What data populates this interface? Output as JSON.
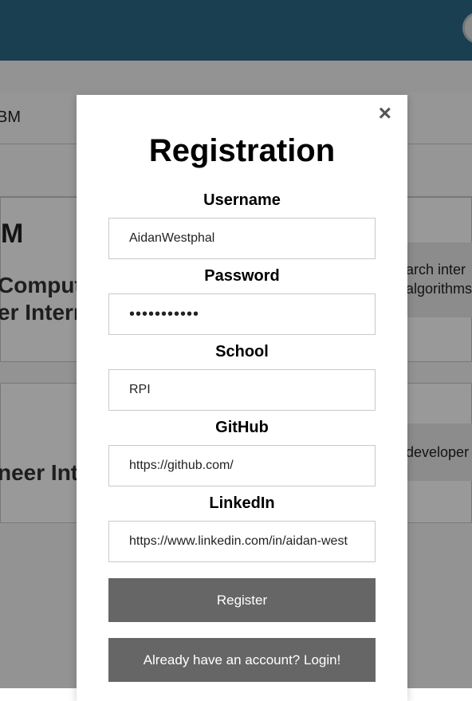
{
  "header": {
    "avatar_icon": "user-avatar-icon"
  },
  "background": {
    "row1_text": "BM",
    "card1": {
      "company": "M",
      "title_line1": "Comput",
      "title_line2": "er Intern",
      "desc_line1": "arch inter",
      "desc_line2": "algorithms"
    },
    "card2": {
      "title": "neer Int",
      "desc": "developer"
    }
  },
  "modal": {
    "close_label": "×",
    "title": "Registration",
    "fields": {
      "username": {
        "label": "Username",
        "value": "AidanWestphal"
      },
      "password": {
        "label": "Password",
        "value": "•••••••••••"
      },
      "school": {
        "label": "School",
        "value": "RPI"
      },
      "github": {
        "label": "GitHub",
        "value": "https://github.com/"
      },
      "linkedin": {
        "label": "LinkedIn",
        "value": "https://www.linkedin.com/in/aidan-west"
      }
    },
    "register_label": "Register",
    "login_label": "Already have an account? Login!"
  },
  "colors": {
    "header_bg": "#2c6a86",
    "button_bg": "#666666",
    "overlay": "rgba(0,0,0,0.4)"
  }
}
